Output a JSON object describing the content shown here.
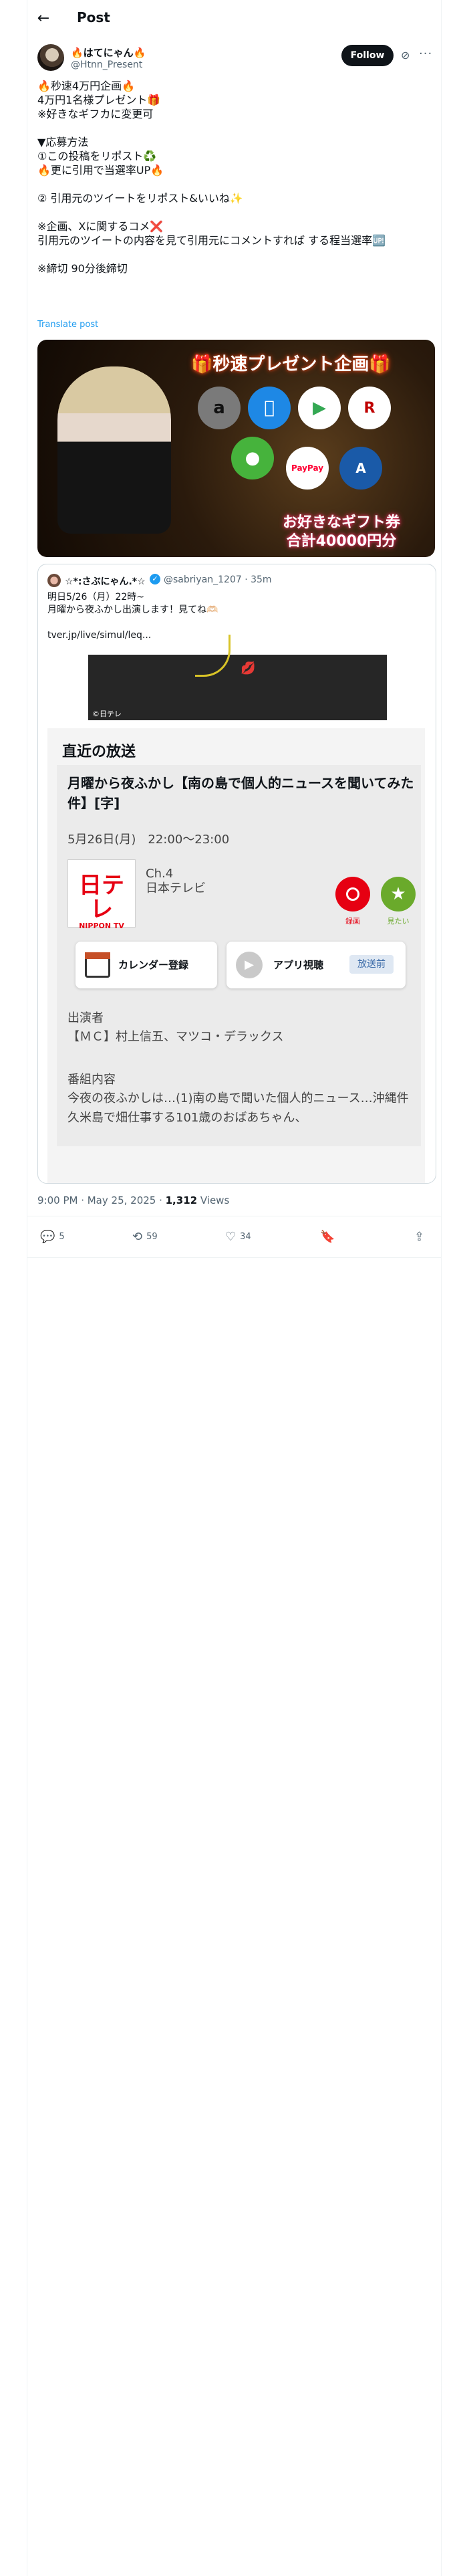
{
  "header": {
    "title": "Post"
  },
  "author": {
    "display_name": "🔥はてにゃん🔥",
    "handle": "@Htnn_Present",
    "follow_label": "Follow"
  },
  "post": {
    "text": "🔥秒速4万円企画🔥\n4万円1名様プレゼント🎁\n※好きなギフカに変更可\n\n▼応募方法\n①この投稿をリポスト♻️\n🔥更に引用で当選率UP🔥\n\n② 引用元のツイートをリポスト&いいね✨\n\n※企画、Xに関するコメ❌\n引用元のツイートの内容を見て引用元にコメントすれば する程当選率🆙\n\n※締切 90分後締切",
    "translate_label": "Translate post"
  },
  "banner": {
    "title": "🎁秒速プレゼント企画🎁",
    "bottom_line1": "お好きなギフト券",
    "bottom_line2": "合計40000円分",
    "icons": [
      "amazon-icon",
      "apple-icon",
      "google-play-icon",
      "rakuten-icon",
      "line-icon",
      "paypay-icon",
      "app-store-card-icon"
    ],
    "icon_texts": {
      "amazon": "a",
      "paypay": "PayPay"
    }
  },
  "quote": {
    "display_name": "☆*:さぶにゃん.*☆",
    "handle_time": "@sabriyan_1207 · 35m",
    "text": "明日5/26（月）22時~\n月曜から夜ふかし出演します！見てね🫶🏻\n\ntver.jp/live/simul/leq...",
    "video_tag": "©日テレ",
    "embed": {
      "heading": "直近の放送",
      "program_title": "月曜から夜ふかし【南の島で個人的ニュースを聞いてみた件】[字]",
      "date": "5月26日(月)　22:00〜23:00",
      "logo_main": "日テレ",
      "logo_sub": "NIPPON TV",
      "channel": "Ch.4",
      "station": "日本テレビ",
      "record_label": "録画",
      "favorite_label": "見たい",
      "calendar_label": "カレンダー登録",
      "app_label": "アプリ視聴",
      "prebroadcast_label": "放送前",
      "cast_heading": "出演者",
      "cast": "【ＭＣ】村上信五、マツコ・デラックス",
      "program_heading": "番組内容",
      "program_text": "今夜の夜ふかしは…(1)南の島で聞いた個人的ニュース…沖縄件久米島で畑仕事する101歳のおばあちゃん、"
    }
  },
  "meta": {
    "time": "9:00 PM · May 25, 2025 · ",
    "views_count": "1,312",
    "views_label": " Views"
  },
  "actions": {
    "replies": "5",
    "reposts": "59",
    "likes": "34"
  }
}
